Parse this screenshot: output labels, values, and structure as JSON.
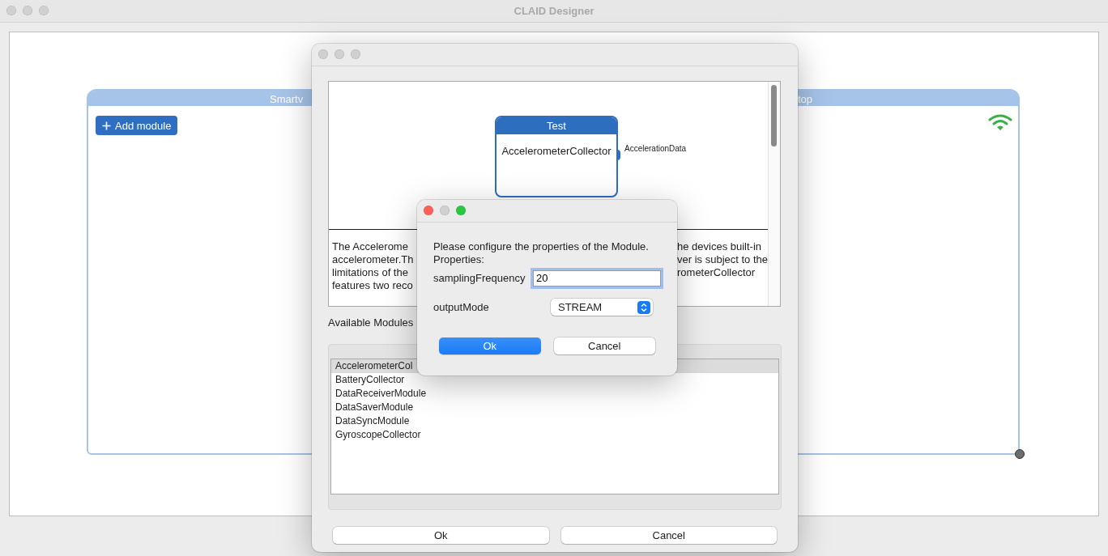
{
  "window": {
    "title": "CLAID Designer",
    "active": false
  },
  "device": {
    "title_left": "Smartv",
    "title_right": "top",
    "add_button": "Add module"
  },
  "module_dialog": {
    "active": false,
    "preview": {
      "node_title": "Test",
      "node_name": "AccelerometerCollector",
      "port_label": "AccelerationData",
      "description_left": [
        "The Accelerome",
        "accelerometer.Th",
        "limitations of the",
        "features two reco"
      ],
      "description_right": [
        "he devices built-in",
        "ver is subject to the",
        "rometerCollector"
      ]
    },
    "list_label": "Available Modules",
    "modules": [
      {
        "name": "AccelerometerCol",
        "selected": true
      },
      {
        "name": "BatteryCollector",
        "selected": false
      },
      {
        "name": "DataReceiverModule",
        "selected": false
      },
      {
        "name": "DataSaverModule",
        "selected": false
      },
      {
        "name": "DataSyncModule",
        "selected": false
      },
      {
        "name": "GyroscopeCollector",
        "selected": false
      }
    ],
    "buttons": [
      "Ok",
      "Cancel"
    ]
  },
  "properties_dialog": {
    "active": true,
    "message": "Please configure the properties of the Module.",
    "heading": "Properties:",
    "fields": [
      {
        "kind": "text",
        "label": "samplingFrequency",
        "value": "20",
        "focused": true
      },
      {
        "kind": "select",
        "label": "outputMode",
        "value": "STREAM"
      }
    ],
    "buttons": [
      {
        "label": "Ok",
        "default": true
      },
      {
        "label": "Cancel",
        "default": false
      }
    ]
  }
}
